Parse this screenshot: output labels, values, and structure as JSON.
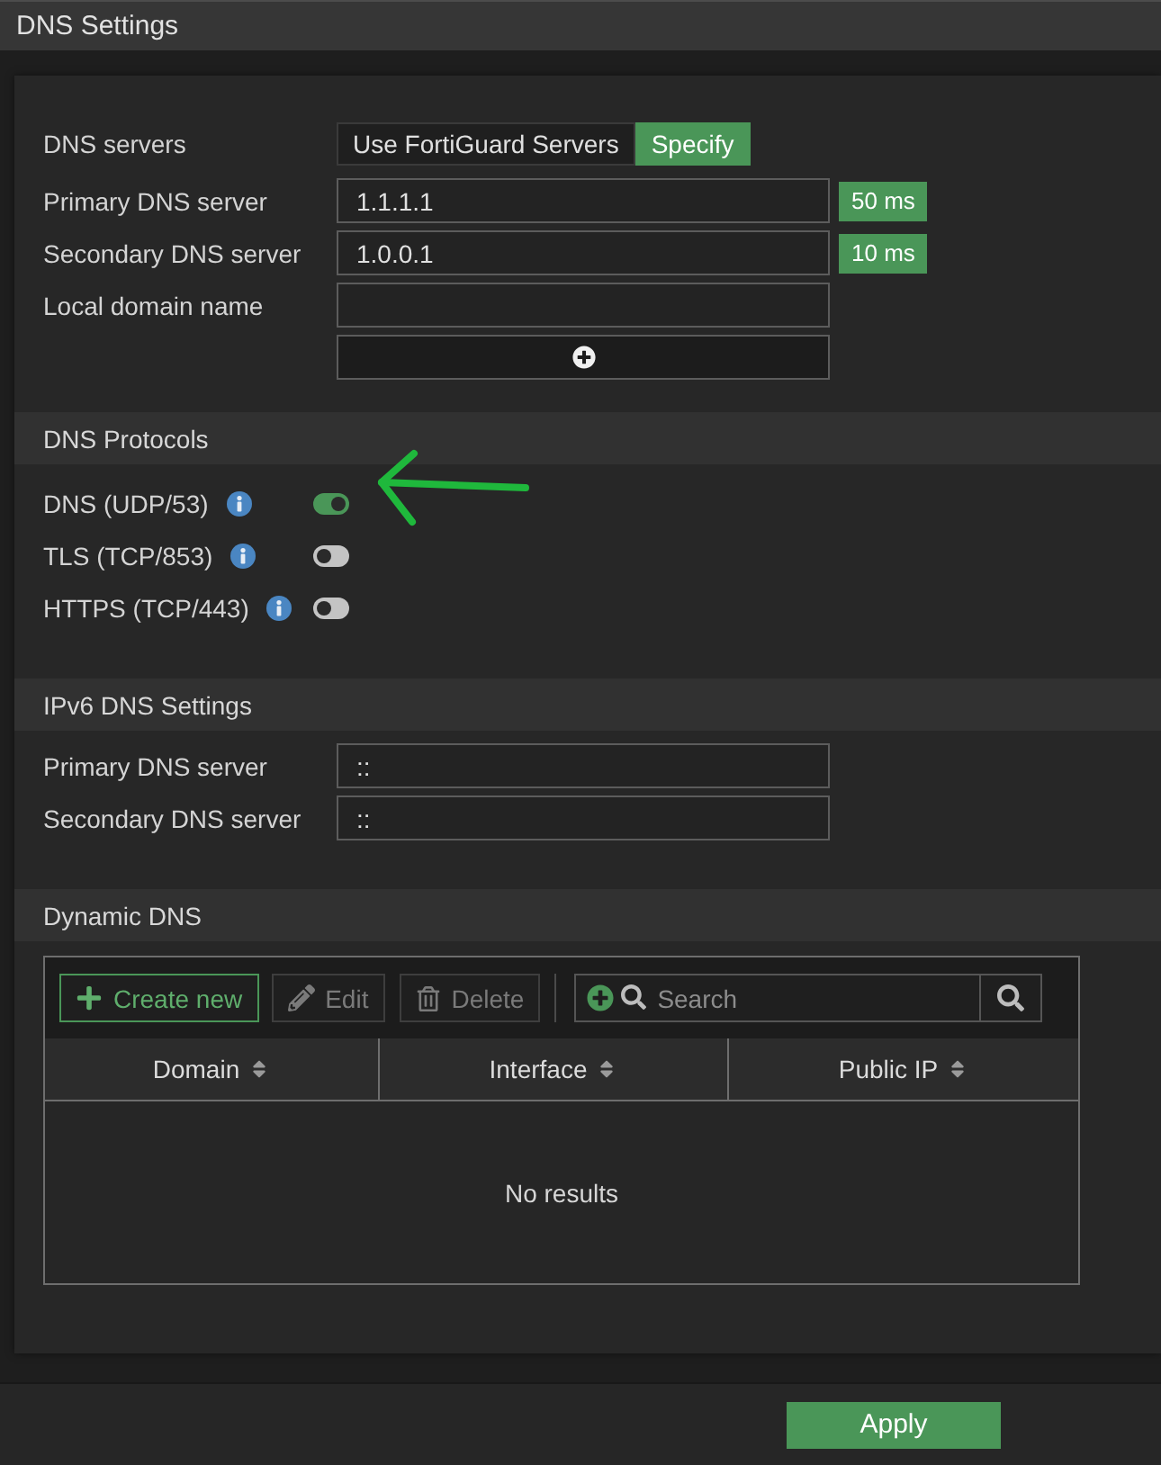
{
  "header": {
    "title": "DNS Settings"
  },
  "dns_servers": {
    "label": "DNS servers",
    "options": [
      {
        "label": "Use FortiGuard Servers",
        "selected": false
      },
      {
        "label": "Specify",
        "selected": true
      }
    ]
  },
  "servers": [
    {
      "label": "Primary DNS server",
      "value": "1.1.1.1",
      "latency": "50 ms"
    },
    {
      "label": "Secondary DNS server",
      "value": "1.0.0.1",
      "latency": "10 ms"
    }
  ],
  "local_domain": {
    "label": "Local domain name"
  },
  "protocols": {
    "title": "DNS Protocols",
    "items": [
      {
        "label": "DNS (UDP/53)",
        "on": true
      },
      {
        "label": "TLS (TCP/853)",
        "on": false
      },
      {
        "label": "HTTPS (TCP/443)",
        "on": false
      }
    ]
  },
  "ipv6": {
    "title": "IPv6 DNS Settings",
    "fields": [
      {
        "label": "Primary DNS server",
        "value": "::"
      },
      {
        "label": "Secondary DNS server",
        "value": "::"
      }
    ]
  },
  "dynamic_dns": {
    "title": "Dynamic DNS",
    "toolbar": {
      "buttons": [
        {
          "kind": "create",
          "label": "Create new",
          "disabled": false
        },
        {
          "kind": "edit",
          "label": "Edit",
          "disabled": true
        },
        {
          "kind": "delete",
          "label": "Delete",
          "disabled": true
        }
      ],
      "search": {
        "placeholder": "Search"
      }
    },
    "table": {
      "columns": [
        "Domain",
        "Interface",
        "Public IP"
      ],
      "empty_text": "No results"
    }
  },
  "footer": {
    "apply_label": "Apply"
  }
}
